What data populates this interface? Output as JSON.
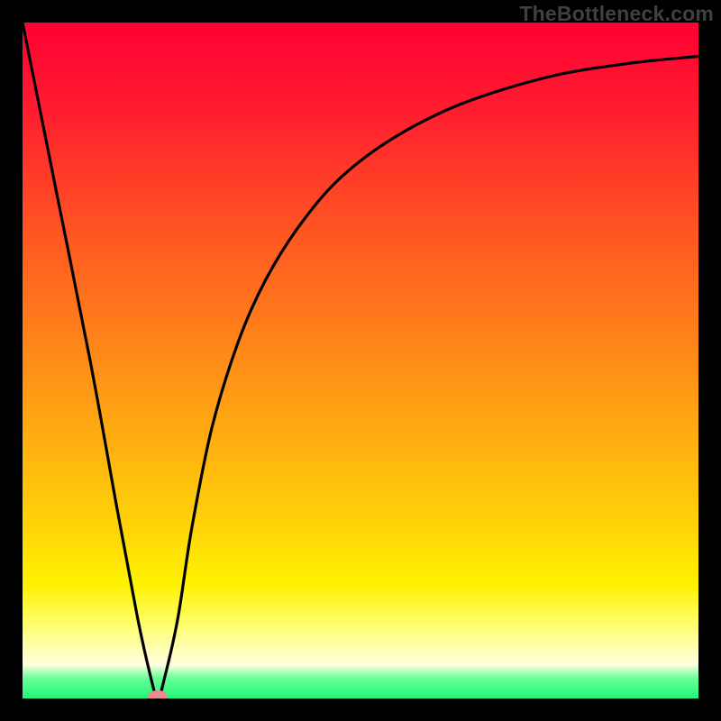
{
  "watermark": "TheBottleneck.com",
  "chart_data": {
    "type": "line",
    "title": "",
    "xlabel": "",
    "ylabel": "",
    "xlim": [
      0,
      100
    ],
    "ylim": [
      0,
      100
    ],
    "grid": false,
    "legend": false,
    "background_gradient": {
      "orientation": "vertical",
      "stops": [
        {
          "pos": 0,
          "color": "#ff0033",
          "meaning": "worst"
        },
        {
          "pos": 50,
          "color": "#ff8c18"
        },
        {
          "pos": 83,
          "color": "#fff200"
        },
        {
          "pos": 100,
          "color": "#21f57a",
          "meaning": "best"
        }
      ]
    },
    "series": [
      {
        "name": "bottleneck-curve",
        "color": "#000000",
        "x": [
          0,
          5,
          10,
          14,
          17,
          19,
          20,
          21,
          23,
          25,
          28,
          32,
          36,
          41,
          47,
          55,
          65,
          78,
          90,
          100
        ],
        "y": [
          100,
          75,
          50,
          28,
          12,
          3,
          0,
          3,
          12,
          25,
          40,
          53,
          62,
          70,
          77,
          83,
          88,
          92,
          94,
          95
        ]
      }
    ],
    "marker": {
      "name": "optimal-point",
      "x": 20,
      "y": 0,
      "color": "#eb8a8f",
      "shape": "ellipse"
    }
  }
}
